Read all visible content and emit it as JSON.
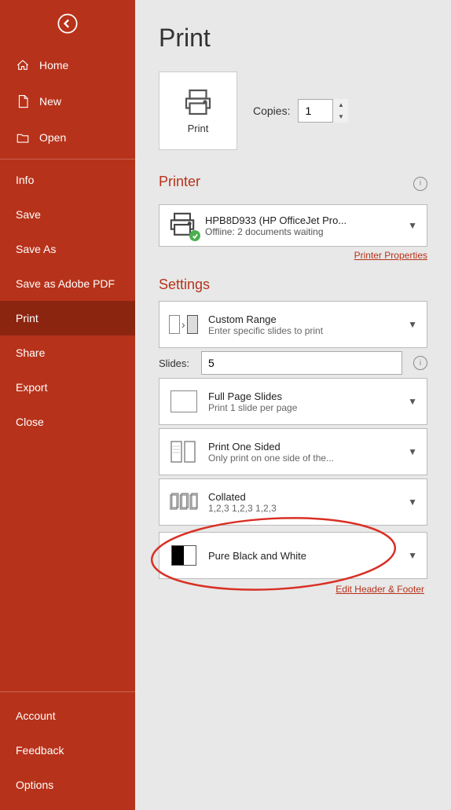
{
  "sidebar": {
    "back_label": "Back",
    "items": [
      {
        "id": "home",
        "label": "Home",
        "icon": "home-icon",
        "active": false
      },
      {
        "id": "new",
        "label": "New",
        "icon": "new-icon",
        "active": false
      },
      {
        "id": "open",
        "label": "Open",
        "icon": "open-icon",
        "active": false
      },
      {
        "id": "info",
        "label": "Info",
        "icon": null,
        "active": false
      },
      {
        "id": "save",
        "label": "Save",
        "icon": null,
        "active": false
      },
      {
        "id": "save-as",
        "label": "Save As",
        "icon": null,
        "active": false
      },
      {
        "id": "save-as-pdf",
        "label": "Save as Adobe PDF",
        "icon": null,
        "active": false
      },
      {
        "id": "print",
        "label": "Print",
        "icon": null,
        "active": true
      },
      {
        "id": "share",
        "label": "Share",
        "icon": null,
        "active": false
      },
      {
        "id": "export",
        "label": "Export",
        "icon": null,
        "active": false
      },
      {
        "id": "close",
        "label": "Close",
        "icon": null,
        "active": false
      }
    ],
    "bottom_items": [
      {
        "id": "account",
        "label": "Account",
        "active": false
      },
      {
        "id": "feedback",
        "label": "Feedback",
        "active": false
      },
      {
        "id": "options",
        "label": "Options",
        "active": false
      }
    ]
  },
  "main": {
    "title": "Print",
    "print_button_label": "Print",
    "copies_label": "Copies:",
    "copies_value": "1",
    "printer_section": {
      "header": "Printer",
      "printer_name": "HPB8D933 (HP OfficeJet Pro...",
      "printer_status": "Offline: 2 documents waiting",
      "properties_link": "Printer Properties"
    },
    "settings_section": {
      "header": "Settings",
      "custom_range": {
        "title": "Custom Range",
        "subtitle": "Enter specific slides to print"
      },
      "slides_label": "Slides:",
      "slides_value": "5",
      "full_page": {
        "title": "Full Page Slides",
        "subtitle": "Print 1 slide per page"
      },
      "print_sided": {
        "title": "Print One Sided",
        "subtitle": "Only print on one side of the..."
      },
      "collated": {
        "title": "Collated",
        "subtitle": "1,2,3   1,2,3   1,2,3"
      },
      "pure_bw": {
        "title": "Pure Black and White",
        "subtitle": ""
      },
      "edit_header_footer": "Edit Header & Footer"
    }
  }
}
